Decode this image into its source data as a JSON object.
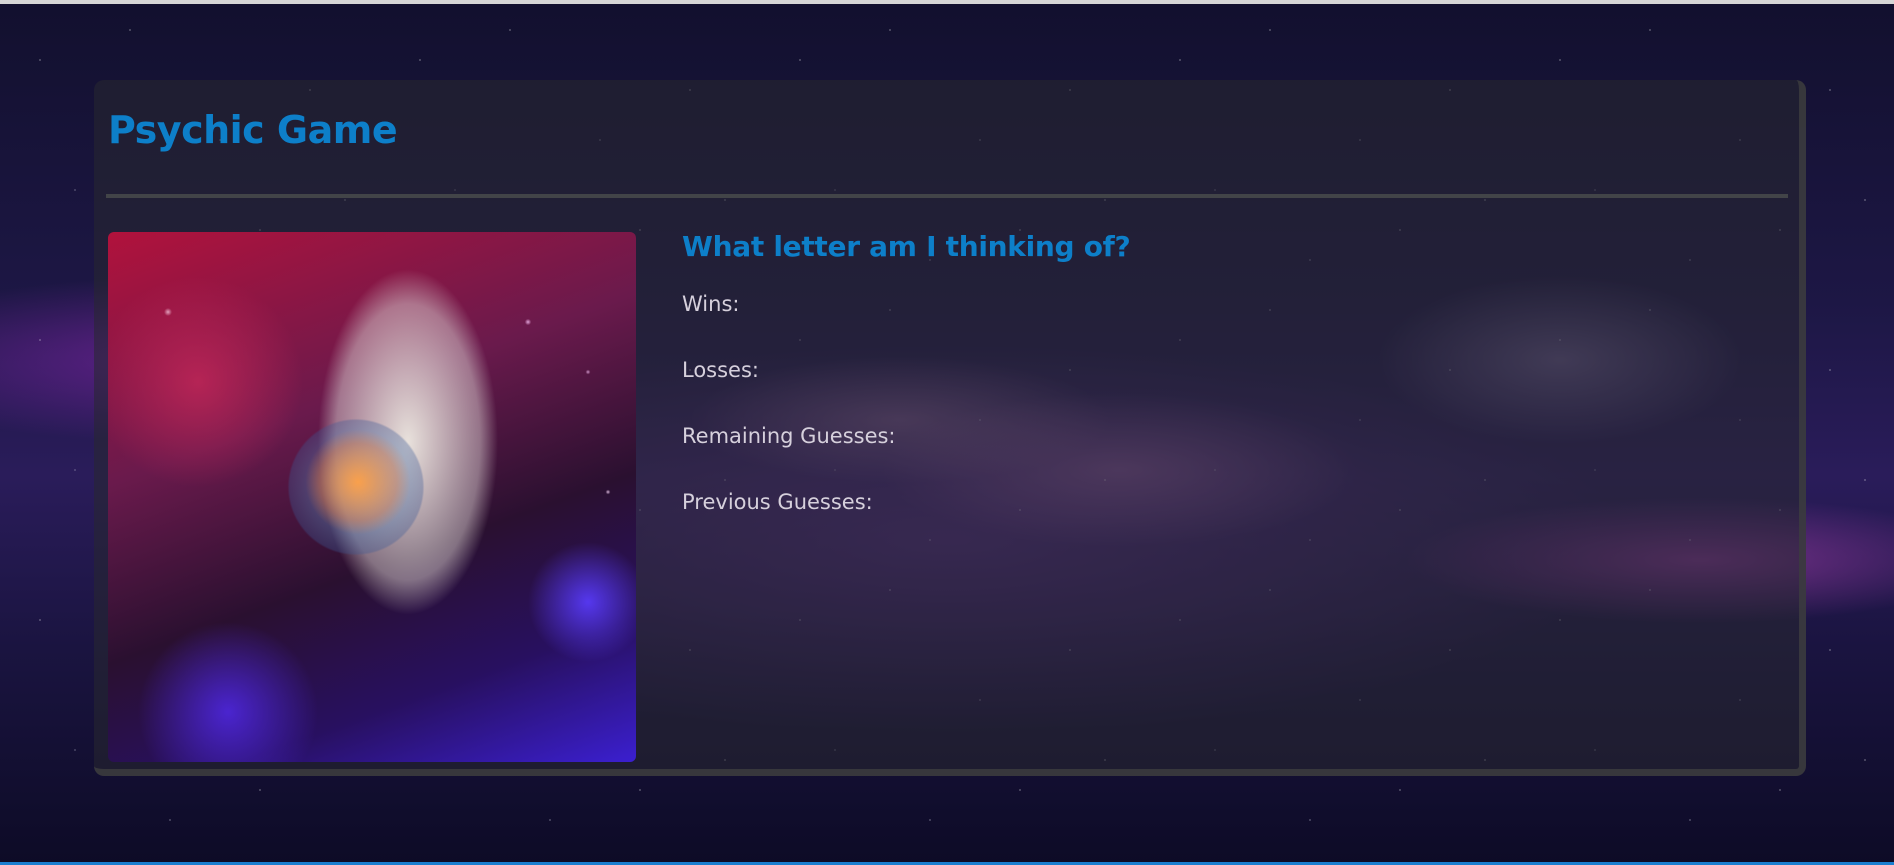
{
  "app": {
    "title": "Psychic Game"
  },
  "game": {
    "question": "What letter am I thinking of?",
    "stats": {
      "wins_label": "Wins:",
      "wins_value": "",
      "losses_label": "Losses:",
      "losses_value": "",
      "remaining_label": "Remaining Guesses:",
      "remaining_value": "",
      "previous_label": "Previous Guesses:",
      "previous_value": ""
    }
  },
  "colors": {
    "accent": "#0d7fc9",
    "text": "#d6d0dc",
    "panel": "#28283080"
  }
}
